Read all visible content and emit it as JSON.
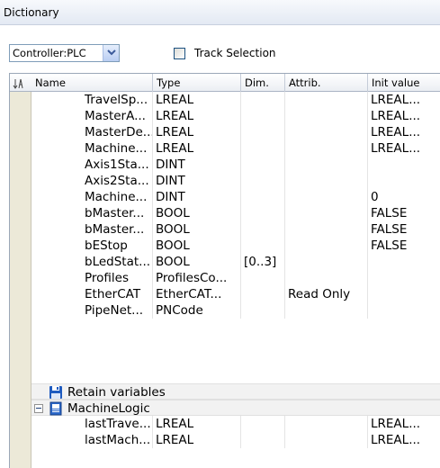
{
  "window": {
    "title": "Dictionary"
  },
  "toolbar": {
    "controller_value": "Controller:PLC",
    "track_label": "Track Selection",
    "track_checked": false
  },
  "columns": {
    "name": "Name",
    "type": "Type",
    "dim": "Dim.",
    "attrib": "Attrib.",
    "init": "Init value"
  },
  "rows": [
    {
      "name": "TravelSp...",
      "type": "LREAL",
      "dim": "",
      "attrib": "",
      "init": "LREAL..."
    },
    {
      "name": "MasterA...",
      "type": "LREAL",
      "dim": "",
      "attrib": "",
      "init": "LREAL..."
    },
    {
      "name": "MasterDe...",
      "type": "LREAL",
      "dim": "",
      "attrib": "",
      "init": "LREAL..."
    },
    {
      "name": "Machine...",
      "type": "LREAL",
      "dim": "",
      "attrib": "",
      "init": "LREAL..."
    },
    {
      "name": "Axis1Sta...",
      "type": "DINT",
      "dim": "",
      "attrib": "",
      "init": ""
    },
    {
      "name": "Axis2Sta...",
      "type": "DINT",
      "dim": "",
      "attrib": "",
      "init": ""
    },
    {
      "name": "Machine...",
      "type": "DINT",
      "dim": "",
      "attrib": "",
      "init": "0"
    },
    {
      "name": "bMaster...",
      "type": "BOOL",
      "dim": "",
      "attrib": "",
      "init": "FALSE"
    },
    {
      "name": "bMaster...",
      "type": "BOOL",
      "dim": "",
      "attrib": "",
      "init": "FALSE"
    },
    {
      "name": "bEStop",
      "type": "BOOL",
      "dim": "",
      "attrib": "",
      "init": "FALSE"
    },
    {
      "name": "bLedStat...",
      "type": "BOOL",
      "dim": "[0..3]",
      "attrib": "",
      "init": ""
    },
    {
      "name": "Profiles",
      "type": "ProfilesCo...",
      "dim": "",
      "attrib": "",
      "init": ""
    },
    {
      "name": "EtherCAT",
      "type": "EtherCAT...",
      "dim": "",
      "attrib": "Read Only",
      "init": ""
    },
    {
      "name": "PipeNet...",
      "type": "PNCode",
      "dim": "",
      "attrib": "",
      "init": ""
    }
  ],
  "groups": {
    "retain": "Retain variables",
    "machine_logic": "MachineLogic"
  },
  "logic_rows": [
    {
      "name": "lastTrave...",
      "type": "LREAL",
      "dim": "",
      "attrib": "",
      "init": "LREAL..."
    },
    {
      "name": "lastMach...",
      "type": "LREAL",
      "dim": "",
      "attrib": "",
      "init": "LREAL..."
    }
  ],
  "icons": {
    "save": "floppy-disk-icon",
    "program": "program-module-icon",
    "sort": "sort-icon",
    "dropdown": "chevron-down-icon"
  },
  "colors": {
    "title_bg": "#e3e9f3",
    "gutter_bg": "#ece9d8",
    "group_bg": "#f2f2f2",
    "accent": "#1f5bbf"
  }
}
